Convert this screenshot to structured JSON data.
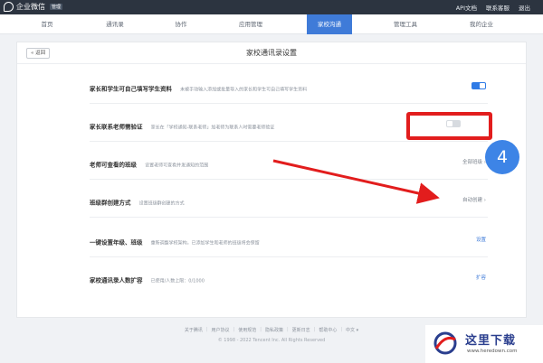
{
  "topbar": {
    "logo_text": "企业微信",
    "logo_badge": "管理",
    "links": [
      "API文档",
      "联系客服",
      "退出"
    ]
  },
  "nav": {
    "items": [
      "首页",
      "通讯录",
      "协作",
      "应用管理",
      "家校沟通",
      "管理工具",
      "我的企业"
    ],
    "active_index": 4
  },
  "panel": {
    "back_label": "« 返回",
    "title": "家校通讯录设置"
  },
  "settings": [
    {
      "title": "家长和学生可自己填写学生资料",
      "desc": "未被手动输入添加或批量导入的家长和学生可自己填写学生资料",
      "control": "toggle",
      "on": true
    },
    {
      "title": "家长联系老师需验证",
      "desc": "家长在「学校通知-联系老师」加老师为联系人时需要老师验证",
      "control": "toggle",
      "on": false
    },
    {
      "title": "老师可查看的班级",
      "desc": "设置老师可查看并发通知的范围",
      "control": "select",
      "value": "全部班级 ›"
    },
    {
      "title": "班级群创建方式",
      "desc": "设置班级群创建的方式",
      "control": "select",
      "value": "自动创建 ›"
    },
    {
      "title": "一键设置年级、班级",
      "desc": "重新调整学校架构，已添加学生和老师的班级将会保留",
      "control": "link",
      "value": "设置"
    },
    {
      "title": "家校通讯录人数扩容",
      "desc": "已使用/人数上限：0/1000",
      "control": "link",
      "value": "扩容"
    }
  ],
  "annotation": {
    "step_number": "4",
    "highlight_color": "#e21d1d",
    "badge_color": "#3d84e6"
  },
  "footer": {
    "links": [
      "关于腾讯",
      "用户协议",
      "使用规范",
      "隐私政策",
      "更新日志",
      "帮助中心",
      "中文 ▾"
    ],
    "copyright": "© 1998 - 2022 Tencent Inc. All Rights Reserved"
  },
  "watermark": {
    "title": "这里下载",
    "url": "www.heredown.com"
  },
  "colors": {
    "accent": "#3f7bd8",
    "topbar": "#2c3440",
    "toggle_on": "#2f7be6"
  }
}
